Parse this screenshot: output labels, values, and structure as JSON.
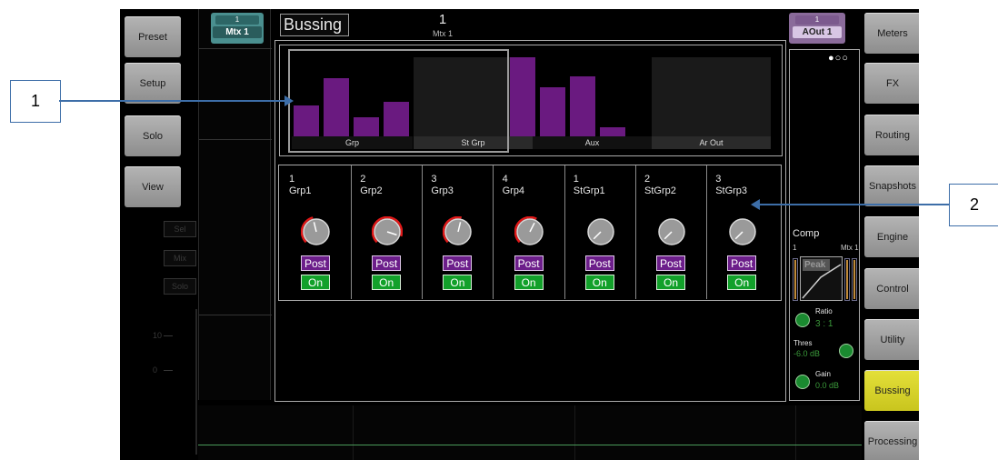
{
  "left_buttons": [
    "Preset",
    "Setup",
    "Solo",
    "View"
  ],
  "left_strip": {
    "buttons": [
      "Sel",
      "Mix",
      "Solo"
    ],
    "scale": [
      "10",
      "0"
    ]
  },
  "right_buttons": [
    "Meters",
    "FX",
    "Routing",
    "Snapshots",
    "Engine",
    "Control",
    "Utility",
    "Bussing",
    "Processing"
  ],
  "active_right": "Bussing",
  "header": {
    "left_channel": {
      "num": "1",
      "name": "Mtx 1"
    },
    "title": "Bussing",
    "center_num": "1",
    "center_name": "Mtx 1",
    "right_channel": {
      "num": "1",
      "name": "AOut 1"
    }
  },
  "overview": {
    "groups": [
      "Grp",
      "St Grp",
      "Aux",
      "Ar Out"
    ],
    "bar_levels": [
      0.39,
      0.73,
      0.24,
      0.44,
      0.0,
      0.0,
      0.0,
      0.0,
      1.0,
      0.62,
      0.76,
      0.12
    ],
    "colors": {
      "bar": "#6a1a80",
      "selection": "#9a9a9a"
    }
  },
  "sends": [
    {
      "num": "1",
      "name": "Grp1",
      "post": "Post",
      "on": "On",
      "level": 0.45
    },
    {
      "num": "2",
      "name": "Grp2",
      "post": "Post",
      "on": "On",
      "level": 0.9
    },
    {
      "num": "3",
      "name": "Grp3",
      "post": "Post",
      "on": "On",
      "level": 0.55
    },
    {
      "num": "4",
      "name": "Grp4",
      "post": "Post",
      "on": "On",
      "level": 0.6
    },
    {
      "num": "1",
      "name": "StGrp1",
      "post": "Post",
      "on": "On",
      "level": 0.0
    },
    {
      "num": "2",
      "name": "StGrp2",
      "post": "Post",
      "on": "On",
      "level": 0.0
    },
    {
      "num": "3",
      "name": "StGrp3",
      "post": "Post",
      "on": "On",
      "level": 0.0
    }
  ],
  "comp": {
    "title": "Comp",
    "left_label": "1",
    "right_label": "Mtx 1",
    "graph_label": "Peak",
    "ratio_label": "Ratio",
    "ratio_value": "3 : 1",
    "thres_label": "Thres",
    "thres_value": "-6.0 dB",
    "gain_label": "Gain",
    "gain_value": "0.0 dB"
  },
  "callouts": [
    "1",
    "2"
  ],
  "colors": {
    "accent_yellow": "#e0dc30",
    "post_purple": "#6c1e8a",
    "on_green": "#12a02a",
    "teal": "#4fa0a0"
  }
}
